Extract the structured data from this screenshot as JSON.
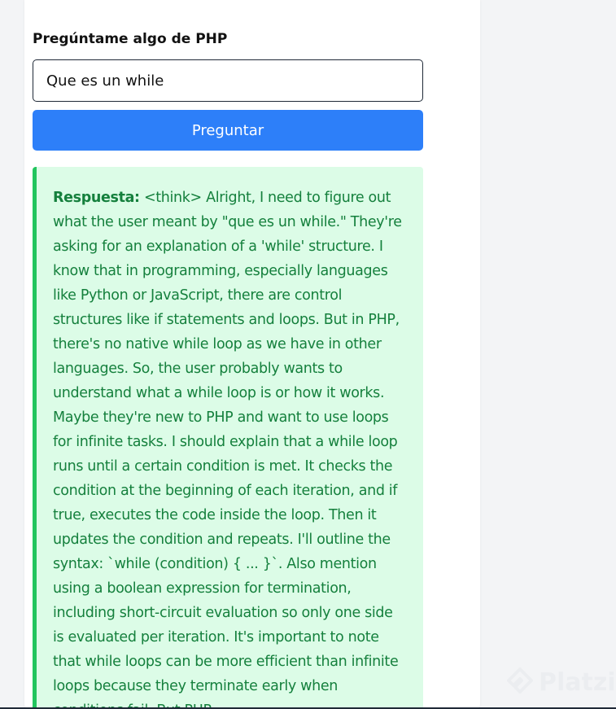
{
  "form": {
    "label": "Pregúntame algo de PHP",
    "input_value": "Que es un while",
    "button_label": "Preguntar"
  },
  "answer": {
    "label": "Respuesta:",
    "text": "<think> Alright, I need to figure out what the user meant by \"que es un while.\" They're asking for an explanation of a 'while' structure. I know that in programming, especially languages like Python or JavaScript, there are control structures like if statements and loops. But in PHP, there's no native while loop as we have in other languages. So, the user probably wants to understand what a while loop is or how it works. Maybe they're new to PHP and want to use loops for infinite tasks. I should explain that a while loop runs until a certain condition is met. It checks the condition at the beginning of each iteration, and if true, executes the code inside the loop. Then it updates the condition and repeats. I'll outline the syntax: `while (condition) { ... }`. Also mention using a boolean expression for termination, including short-circuit evaluation so only one side is evaluated per iteration. It's important to note that while loops can be more efficient than infinite loops because they terminate early when conditions fail. But PHP"
  },
  "watermark": {
    "text": "Platzi",
    "icon": "platzi-logo-icon"
  },
  "colors": {
    "page_bg": "#f3f4f6",
    "card_bg": "#ffffff",
    "button": "#2d7ff9",
    "answer_bg": "#dcfce7",
    "answer_border": "#22c55e",
    "answer_text": "#15803d"
  }
}
